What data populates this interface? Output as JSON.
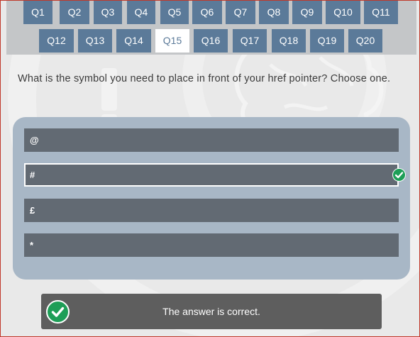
{
  "questions": {
    "row1": [
      "Q1",
      "Q2",
      "Q3",
      "Q4",
      "Q5",
      "Q6",
      "Q7",
      "Q8",
      "Q9",
      "Q10",
      "Q11"
    ],
    "row2": [
      "Q12",
      "Q13",
      "Q14",
      "Q15",
      "Q16",
      "Q17",
      "Q18",
      "Q19",
      "Q20"
    ],
    "active": "Q15"
  },
  "question_text": "What is the symbol you need to place in front of your href pointer? Choose one.",
  "options": [
    "@",
    "#",
    "£",
    "*"
  ],
  "selected_option": "#",
  "feedback": {
    "text": "The answer is correct.",
    "icon": "checkmark-icon"
  },
  "colors": {
    "accent": "#5b7a99",
    "option_bg": "#626a73",
    "panel_bg": "#a8b7c6",
    "success": "#1e9e57"
  }
}
